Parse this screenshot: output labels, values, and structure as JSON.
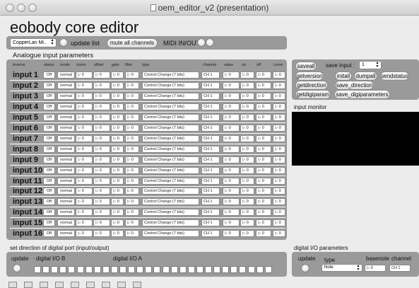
{
  "window": {
    "title": "oem_editor_v2 (presentation)"
  },
  "app_title": "eobody core editor",
  "toolbar": {
    "device": "CopperLan Mi..",
    "update_list": "update list",
    "mute_all": "mute all channels",
    "midi_inout": "MIDI IN/OUT"
  },
  "analogue": {
    "title": "Analogue input parameters",
    "headers": [
      "inverse",
      "status",
      "mode",
      "zoom",
      "offset",
      "gate",
      "filter",
      "type",
      "channel",
      "value",
      "on",
      "off",
      "curve"
    ],
    "rows": [
      {
        "label": "input 1",
        "status": "Off",
        "mode": "normal",
        "zoom": "▷ 0",
        "offset": "▷ 0",
        "gate": "▷ 0",
        "filter": "▷ 0",
        "type": "Control Change (7 bits)",
        "channel": "CH 1",
        "value": "▷ 0",
        "on": "▷ 0",
        "off": "▷ 0",
        "curve": "▷ 0"
      },
      {
        "label": "input 2",
        "status": "Off",
        "mode": "normal",
        "zoom": "▷ 0",
        "offset": "▷ 0",
        "gate": "▷ 0",
        "filter": "▷ 0",
        "type": "Control Change (7 bits)",
        "channel": "CH 1",
        "value": "▷ 0",
        "on": "▷ 0",
        "off": "▷ 0",
        "curve": "▷ 0"
      },
      {
        "label": "input 3",
        "status": "Off",
        "mode": "normal",
        "zoom": "▷ 0",
        "offset": "▷ 0",
        "gate": "▷ 0",
        "filter": "▷ 0",
        "type": "Control Change (7 bits)",
        "channel": "CH 1",
        "value": "▷ 0",
        "on": "▷ 0",
        "off": "▷ 0",
        "curve": "▷ 0"
      },
      {
        "label": "input 4",
        "status": "Off",
        "mode": "normal",
        "zoom": "▷ 0",
        "offset": "▷ 0",
        "gate": "▷ 0",
        "filter": "▷ 0",
        "type": "Control Change (7 bits)",
        "channel": "CH 1",
        "value": "▷ 0",
        "on": "▷ 0",
        "off": "▷ 0",
        "curve": "▷ 0"
      },
      {
        "label": "input 5",
        "status": "Off",
        "mode": "normal",
        "zoom": "▷ 0",
        "offset": "▷ 0",
        "gate": "▷ 0",
        "filter": "▷ 0",
        "type": "Control Change (7 bits)",
        "channel": "CH 1",
        "value": "▷ 0",
        "on": "▷ 0",
        "off": "▷ 0",
        "curve": "▷ 0"
      },
      {
        "label": "input 6",
        "status": "Off",
        "mode": "normal",
        "zoom": "▷ 0",
        "offset": "▷ 0",
        "gate": "▷ 0",
        "filter": "▷ 0",
        "type": "Control Change (7 bits)",
        "channel": "CH 1",
        "value": "▷ 0",
        "on": "▷ 0",
        "off": "▷ 0",
        "curve": "▷ 0"
      },
      {
        "label": "input 7",
        "status": "Off",
        "mode": "normal",
        "zoom": "▷ 0",
        "offset": "▷ 0",
        "gate": "▷ 0",
        "filter": "▷ 0",
        "type": "Control Change (7 bits)",
        "channel": "CH 1",
        "value": "▷ 0",
        "on": "▷ 0",
        "off": "▷ 0",
        "curve": "▷ 0"
      },
      {
        "label": "input 8",
        "status": "Off",
        "mode": "normal",
        "zoom": "▷ 0",
        "offset": "▷ 0",
        "gate": "▷ 0",
        "filter": "▷ 0",
        "type": "Control Change (7 bits)",
        "channel": "CH 1",
        "value": "▷ 0",
        "on": "▷ 0",
        "off": "▷ 0",
        "curve": "▷ 0"
      },
      {
        "label": "input 9",
        "status": "Off",
        "mode": "normal",
        "zoom": "▷ 0",
        "offset": "▷ 0",
        "gate": "▷ 0",
        "filter": "▷ 0",
        "type": "Control Change (7 bits)",
        "channel": "CH 1",
        "value": "▷ 0",
        "on": "▷ 0",
        "off": "▷ 0",
        "curve": "▷ 0"
      },
      {
        "label": "input 10",
        "status": "Off",
        "mode": "normal",
        "zoom": "▷ 0",
        "offset": "▷ 0",
        "gate": "▷ 0",
        "filter": "▷ 0",
        "type": "Control Change (7 bits)",
        "channel": "CH 1",
        "value": "▷ 0",
        "on": "▷ 0",
        "off": "▷ 0",
        "curve": "▷ 0"
      },
      {
        "label": "input 11",
        "status": "Off",
        "mode": "normal",
        "zoom": "▷ 0",
        "offset": "▷ 0",
        "gate": "▷ 0",
        "filter": "▷ 0",
        "type": "Control Change (7 bits)",
        "channel": "CH 1",
        "value": "▷ 0",
        "on": "▷ 0",
        "off": "▷ 0",
        "curve": "▷ 0"
      },
      {
        "label": "input 12",
        "status": "Off",
        "mode": "normal",
        "zoom": "▷ 0",
        "offset": "▷ 0",
        "gate": "▷ 0",
        "filter": "▷ 0",
        "type": "Control Change (7 bits)",
        "channel": "CH 1",
        "value": "▷ 0",
        "on": "▷ 0",
        "off": "▷ 0",
        "curve": "▷ 0"
      },
      {
        "label": "input 13",
        "status": "Off",
        "mode": "normal",
        "zoom": "▷ 0",
        "offset": "▷ 0",
        "gate": "▷ 0",
        "filter": "▷ 0",
        "type": "Control Change (7 bits)",
        "channel": "CH 1",
        "value": "▷ 0",
        "on": "▷ 0",
        "off": "▷ 0",
        "curve": "▷ 0"
      },
      {
        "label": "input 14",
        "status": "Off",
        "mode": "normal",
        "zoom": "▷ 0",
        "offset": "▷ 0",
        "gate": "▷ 0",
        "filter": "▷ 0",
        "type": "Control Change (7 bits)",
        "channel": "CH 1",
        "value": "▷ 0",
        "on": "▷ 0",
        "off": "▷ 0",
        "curve": "▷ 0"
      },
      {
        "label": "input 15",
        "status": "Off",
        "mode": "normal",
        "zoom": "▷ 0",
        "offset": "▷ 0",
        "gate": "▷ 0",
        "filter": "▷ 0",
        "type": "Control Change (7 bits)",
        "channel": "CH 1",
        "value": "▷ 0",
        "on": "▷ 0",
        "off": "▷ 0",
        "curve": "▷ 0"
      },
      {
        "label": "input 16",
        "status": "Off",
        "mode": "normal",
        "zoom": "▷ 0",
        "offset": "▷ 0",
        "gate": "▷ 0",
        "filter": "▷ 0",
        "type": "Control Change (7 bits)",
        "channel": "CH 1",
        "value": "▷ 0",
        "on": "▷ 0",
        "off": "▷ 0",
        "curve": "▷ 0"
      }
    ]
  },
  "actions": {
    "saveall": "saveall",
    "save_input_label": "save input :",
    "save_input_value": "1",
    "getversion": "getversion",
    "initall": "initall",
    "dumpall": "dumpall",
    "sendstatus": "sendstatus",
    "getdirection": "getdirection",
    "save_direction": "save_direction",
    "getdigiparam": "getdigiparam",
    "save_digiparameters": "save_digiparameters"
  },
  "monitor": {
    "title": "input monitor"
  },
  "digital_dir": {
    "title": "set direction of digital port (input/output)",
    "update": "update",
    "io_b": "digital I/O B",
    "io_a": "digital I/O A",
    "bits": [
      0,
      0,
      0,
      0,
      0,
      0,
      0,
      0,
      0,
      0,
      0,
      0,
      0,
      0,
      0,
      0,
      0,
      0,
      0,
      0,
      0,
      0,
      0,
      0,
      0,
      0,
      0,
      0
    ]
  },
  "digital_params": {
    "title": "digital I/O parameters",
    "update": "update",
    "type_label": "type",
    "basenote_label": "basenote",
    "channel_label": "channel",
    "type_value": "Note",
    "basenote_value": "▷ 0",
    "channel_value": "CH 1"
  },
  "taskbar": {
    "icons": [
      "folder-icon",
      "plus-icon",
      "grid-icon",
      "mail-icon",
      "info-icon",
      "copy-icon",
      "window-icon",
      "table-icon",
      "table2-icon"
    ]
  }
}
